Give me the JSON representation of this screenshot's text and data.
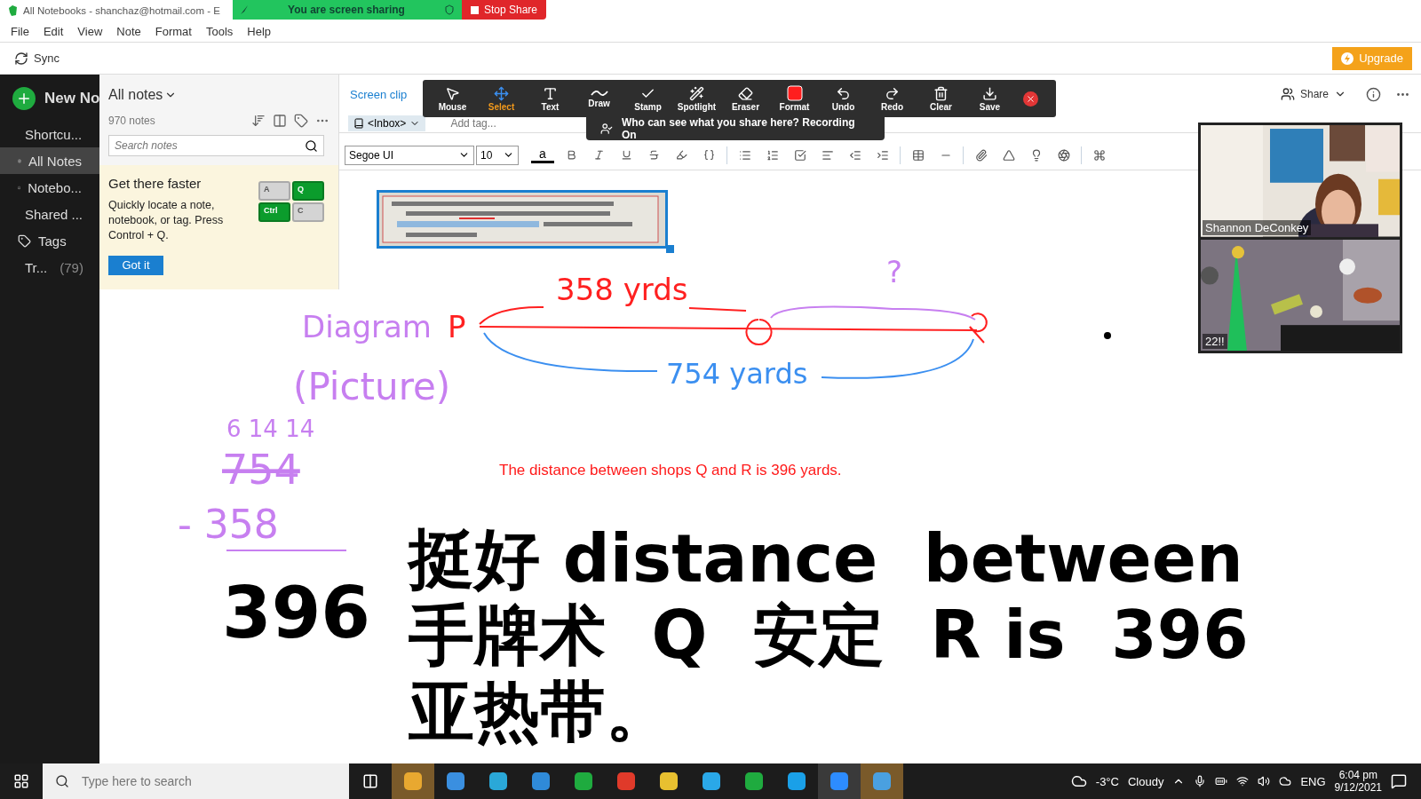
{
  "window": {
    "title": "All Notebooks - shanchaz@hotmail.com - E"
  },
  "share_banner": {
    "status": "You are screen sharing",
    "stop": "Stop Share"
  },
  "menu": [
    "File",
    "Edit",
    "View",
    "Note",
    "Format",
    "Tools",
    "Help"
  ],
  "toolbar": {
    "sync": "Sync",
    "upgrade": "Upgrade"
  },
  "sidebar": {
    "new_note": "New No",
    "items": [
      {
        "kind": "shortcuts",
        "label": "Shortcu...",
        "selected": false
      },
      {
        "kind": "notes",
        "label": "All Notes",
        "selected": true
      },
      {
        "kind": "notebooks",
        "label": "Notebo...",
        "selected": false
      },
      {
        "kind": "shared",
        "label": "Shared ...",
        "selected": false
      },
      {
        "kind": "tags",
        "label": "Tags",
        "selected": false
      },
      {
        "kind": "trash",
        "label": "Tr...",
        "count": "(79)",
        "selected": false
      }
    ]
  },
  "note_list": {
    "title": "All notes",
    "count": "970 notes",
    "search": {
      "placeholder": "Search notes"
    },
    "tip": {
      "title": "Get there faster",
      "body": "Quickly locate a note, notebook, or tag. Press Control + Q.",
      "button": "Got it",
      "keys": [
        {
          "label": "A",
          "on": false
        },
        {
          "label": "Q",
          "on": true
        },
        {
          "label": "Ctrl",
          "on": true
        },
        {
          "label": "C",
          "on": false
        }
      ]
    }
  },
  "editor": {
    "screen_clip": "Screen clip",
    "notebook": "<Inbox>",
    "tag": {
      "placeholder": "Add tag..."
    },
    "font": "Segoe UI",
    "size": "10",
    "text_color": "a"
  },
  "annotation_toolbar": {
    "tools": [
      {
        "kind": "mouse",
        "label": "Mouse",
        "selected": false
      },
      {
        "kind": "select",
        "label": "Select",
        "selected": true
      },
      {
        "kind": "text",
        "label": "Text",
        "selected": false
      },
      {
        "kind": "draw",
        "label": "Draw",
        "selected": false
      },
      {
        "kind": "stamp",
        "label": "Stamp",
        "selected": false
      },
      {
        "kind": "spotlight",
        "label": "Spotlight",
        "selected": false
      },
      {
        "kind": "eraser",
        "label": "Eraser",
        "selected": false
      },
      {
        "kind": "format",
        "label": "Format",
        "selected": false
      },
      {
        "kind": "undo",
        "label": "Undo",
        "selected": false
      },
      {
        "kind": "redo",
        "label": "Redo",
        "selected": false
      },
      {
        "kind": "clear",
        "label": "Clear",
        "selected": false
      },
      {
        "kind": "save",
        "label": "Save",
        "selected": false
      }
    ],
    "notice": "Who can see what you share here? Recording On"
  },
  "share_controls": {
    "share": "Share"
  },
  "videos": [
    {
      "name": "Shannon DeConkey",
      "kind": "person"
    },
    {
      "name": "22!!",
      "kind": "room"
    }
  ],
  "note": {
    "clip": {
      "kind": "picture"
    },
    "answer": "The distance between shops Q and R is 396 yards.",
    "big_text": [
      "挺好 distance  between",
      "手牌术  Q  安定  R is  396",
      "亚热带。"
    ]
  },
  "annotations": [
    {
      "text": "Diagram",
      "color": "#c77ff0"
    },
    {
      "text": "(Picture)",
      "color": "#c77ff0"
    },
    {
      "text": "P",
      "color": "#ff2020"
    },
    {
      "text": "358 yrds",
      "color": "#ff2020"
    },
    {
      "text": "?",
      "color": "#c77ff0"
    },
    {
      "text": "754 yards",
      "color": "#3b8ff0"
    },
    {
      "text": "6 14 14",
      "color": "#c77ff0"
    },
    {
      "text": "754",
      "color": "#c77ff0"
    },
    {
      "text": "- 358",
      "color": "#c77ff0"
    },
    {
      "text": "396",
      "color": "#000000"
    }
  ],
  "taskbar": {
    "search": {
      "placeholder": "Type here to search"
    },
    "temperature": "-3°C",
    "weather": "Cloudy",
    "language": "ENG",
    "time": "6:04 pm",
    "date": "9/12/2021"
  }
}
